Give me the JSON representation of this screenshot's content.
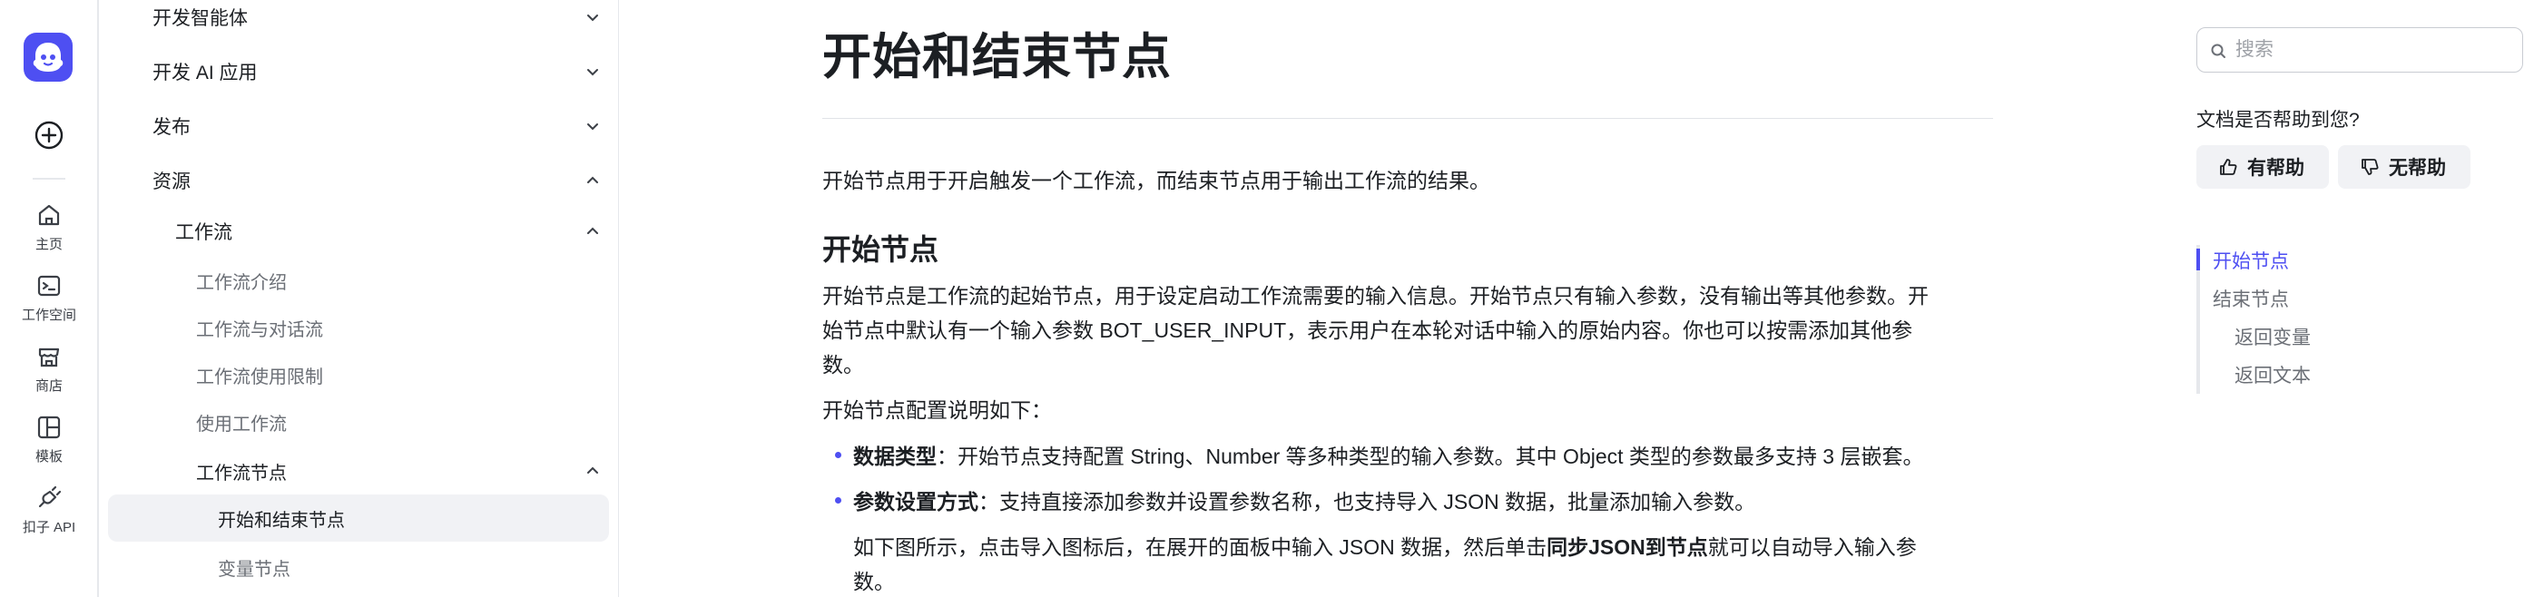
{
  "rail": {
    "items": [
      {
        "label": "主页",
        "icon": "home-icon"
      },
      {
        "label": "工作空间",
        "icon": "workspace-icon"
      },
      {
        "label": "商店",
        "icon": "store-icon"
      },
      {
        "label": "模板",
        "icon": "template-icon"
      },
      {
        "label": "扣子 API",
        "icon": "api-icon"
      }
    ]
  },
  "nav": {
    "items": [
      {
        "label": "开发智能体",
        "expanded": false
      },
      {
        "label": "开发 AI 应用",
        "expanded": false
      },
      {
        "label": "发布",
        "expanded": false
      },
      {
        "label": "资源",
        "expanded": true
      },
      {
        "label": "工作流",
        "expanded": true
      },
      {
        "label": "工作流介绍"
      },
      {
        "label": "工作流与对话流"
      },
      {
        "label": "工作流使用限制"
      },
      {
        "label": "使用工作流"
      },
      {
        "label": "工作流节点",
        "expanded": true
      },
      {
        "label": "开始和结束节点",
        "active": true
      },
      {
        "label": "变量节点"
      }
    ]
  },
  "main": {
    "title": "开始和结束节点",
    "intro": "开始节点用于开启触发一个工作流，而结束节点用于输出工作流的结果。",
    "section_title": "开始节点",
    "section_lines": [
      "开始节点是工作流的起始节点，用于设定启动工作流需要的输入信息。开始节点只有输入参数，没有输出等其他参数。开",
      "始节点中默认有一个输入参数 BOT_USER_INPUT，表示用户在本轮对话中输入的原始内容。你也可以按需添加其他参",
      "数。"
    ],
    "config_intro": "开始节点配置说明如下：",
    "bullets": [
      {
        "term": "数据类型",
        "text": "：开始节点支持配置 String、Number 等多种类型的输入参数。其中 Object 类型的参数最多支持 3 层嵌套。"
      },
      {
        "term": "参数设置方式",
        "text": "：支持直接添加参数并设置参数名称，也支持导入 JSON 数据，批量添加输入参数。"
      }
    ],
    "note_before": "如下图所示，点击导入图标后，在展开的面板中输入 JSON 数据，然后单击",
    "note_bold": "同步JSON到节点",
    "note_after": "就可以自动导入输入参",
    "note_line2": "数。"
  },
  "right": {
    "search_placeholder": "搜索",
    "helpful_question": "文档是否帮助到您?",
    "helpful_yes": "有帮助",
    "helpful_no": "无帮助",
    "toc": [
      {
        "label": "开始节点",
        "active": true
      },
      {
        "label": "结束节点"
      },
      {
        "label": "返回变量"
      },
      {
        "label": "返回文本"
      }
    ]
  },
  "colors": {
    "accent": "#4e4ff2",
    "text": "#1c1f23",
    "muted": "#6b6f76",
    "active_bg": "#f1f2f5"
  }
}
